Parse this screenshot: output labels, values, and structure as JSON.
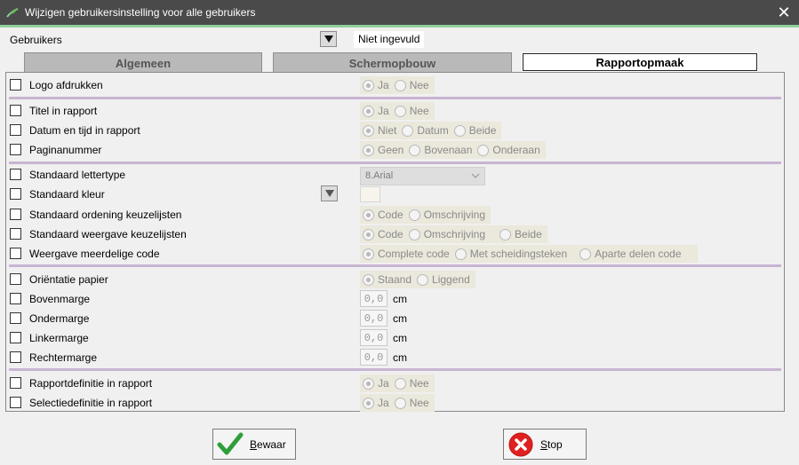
{
  "window": {
    "title": "Wijzigen gebruikersinstelling voor alle gebruikers",
    "close": "✕"
  },
  "users": {
    "label": "Gebruikers",
    "value": "Niet ingevuld"
  },
  "tabs": [
    "Algemeen",
    "Schermopbouw",
    "Rapportopmaak"
  ],
  "active_tab": "Rapportopmaak",
  "rows": {
    "logo": {
      "label": "Logo afdrukken",
      "options": [
        "Ja",
        "Nee"
      ]
    },
    "titel": {
      "label": "Titel in rapport",
      "options": [
        "Ja",
        "Nee"
      ]
    },
    "datum": {
      "label": "Datum en tijd in rapport",
      "options": [
        "Niet",
        "Datum",
        "Beide"
      ]
    },
    "pagina": {
      "label": "Paginanummer",
      "options": [
        "Geen",
        "Bovenaan",
        "Onderaan"
      ]
    },
    "lettertype": {
      "label": "Standaard lettertype",
      "value": "8.Arial"
    },
    "kleur": {
      "label": "Standaard kleur"
    },
    "ordening": {
      "label": "Standaard ordening keuzelijsten",
      "options": [
        "Code",
        "Omschrijving"
      ]
    },
    "weergave": {
      "label": "Standaard weergave keuzelijsten",
      "options": [
        "Code",
        "Omschrijving",
        "Beide"
      ]
    },
    "meerdelig": {
      "label": "Weergave meerdelige code",
      "options": [
        "Complete code",
        "Met scheidingsteken",
        "Aparte delen code"
      ]
    },
    "orientatie": {
      "label": "Oriëntatie papier",
      "options": [
        "Staand",
        "Liggend"
      ]
    },
    "bovenmarge": {
      "label": "Bovenmarge",
      "value": "0,0",
      "unit": "cm"
    },
    "ondermarge": {
      "label": "Ondermarge",
      "value": "0,0",
      "unit": "cm"
    },
    "linkermarge": {
      "label": "Linkermarge",
      "value": "0,0",
      "unit": "cm"
    },
    "rechtermarge": {
      "label": "Rechtermarge",
      "value": "0,0",
      "unit": "cm"
    },
    "rapportdef": {
      "label": "Rapportdefinitie in rapport",
      "options": [
        "Ja",
        "Nee"
      ]
    },
    "selectiedef": {
      "label": "Selectiedefinitie in rapport",
      "options": [
        "Ja",
        "Nee"
      ]
    }
  },
  "buttons": {
    "save_first": "B",
    "save_rest": "ewaar",
    "stop_first": "S",
    "stop_rest": "top"
  },
  "colors": {
    "titlebar": "#4a4a4a",
    "accent_line": "#8fd19a",
    "separator": "#c8b4d2",
    "save_check": "#2e9e3a",
    "stop_red": "#e02020"
  },
  "icons": {
    "app": "leaf-icon",
    "close": "close-icon",
    "save": "check-icon",
    "stop": "stop-x-icon",
    "dropdown": "triangle-down-icon"
  }
}
